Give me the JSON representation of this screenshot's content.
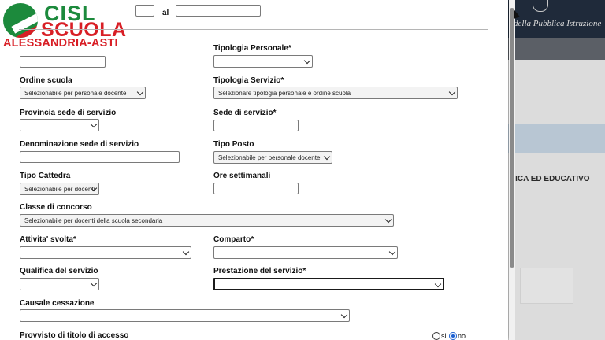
{
  "logo": {
    "cisl": "CISL",
    "scuola": "SCUOLA",
    "region": "ALESSANDRIA-ASTI"
  },
  "background": {
    "header_text": "della Pubblica Istruzione",
    "section_text": "LICA ED EDUCATIVO"
  },
  "period": {
    "to_label": "al",
    "from_value": "",
    "to_value": ""
  },
  "form": {
    "tipologia_personale": {
      "label": "Tipologia Personale*",
      "value": ""
    },
    "ordine_scuola": {
      "label": "Ordine scuola",
      "value": "Selezionabile per personale docente"
    },
    "tipologia_servizio": {
      "label": "Tipologia Servizio*",
      "value": "Selezionare tipologia personale e ordine scuola"
    },
    "provincia_sede": {
      "label": "Provincia sede di servizio",
      "value": ""
    },
    "sede_servizio": {
      "label": "Sede di servizio*",
      "value": ""
    },
    "denominazione_sede": {
      "label": "Denominazione sede di servizio",
      "value": ""
    },
    "tipo_posto": {
      "label": "Tipo Posto",
      "value": "Selezionabile per personale docente"
    },
    "tipo_cattedra": {
      "label": "Tipo Cattedra",
      "value": "Selezionabile per docenti"
    },
    "ore_settimanali": {
      "label": "Ore settimanali",
      "value": ""
    },
    "classe_concorso": {
      "label": "Classe di concorso",
      "value": "Selezionabile per docenti della scuola secondaria"
    },
    "attivita_svolta": {
      "label": "Attivita' svolta*",
      "value": ""
    },
    "comparto": {
      "label": "Comparto*",
      "value": ""
    },
    "qualifica": {
      "label": "Qualifica del servizio",
      "value": ""
    },
    "prestazione": {
      "label": "Prestazione del servizio*",
      "value": ""
    },
    "causale_cessazione": {
      "label": "Causale cessazione",
      "value": ""
    },
    "titolo_accesso": {
      "label": "Provvisto di titolo di accesso",
      "options": [
        "si",
        "no"
      ],
      "selected": "no"
    }
  }
}
